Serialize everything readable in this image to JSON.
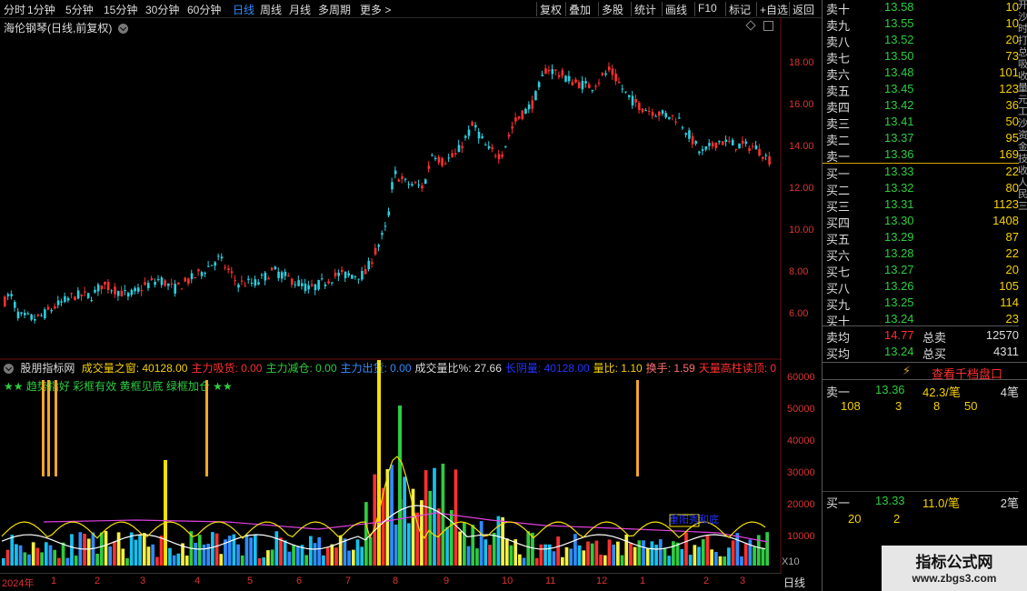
{
  "toolbar": {
    "periods": [
      "分时",
      "1分钟",
      "5分钟",
      "15分钟",
      "30分钟",
      "60分钟",
      "日线",
      "周线",
      "月线",
      "多周期",
      "更多"
    ],
    "more_suffix": "更多 >",
    "right_buttons": [
      "复权",
      "叠加",
      "多股",
      "统计",
      "画线",
      "F10",
      "标记",
      "+自选",
      "返回"
    ]
  },
  "chart_title": "海伦钢琴(日线,前复权)",
  "price_axis": [
    "18.00",
    "16.00",
    "14.00",
    "12.00",
    "10.00",
    "8.00",
    "6.00"
  ],
  "indicator": {
    "name": "股朋指标网",
    "items": [
      {
        "label": "成交量之窗:",
        "value": "40128.00",
        "color": "#f5d000"
      },
      {
        "label": "主力吸货:",
        "value": "0.00",
        "color": "#ff3030"
      },
      {
        "label": "主力减仓:",
        "value": "0.00",
        "color": "#2ecc40"
      },
      {
        "label": "主力出货:",
        "value": "0.00",
        "color": "#2f8cff"
      },
      {
        "label": "成交量比%:",
        "value": "27.66",
        "color": "#ddd"
      },
      {
        "label": "长阴量:",
        "value": "40128.00",
        "color": "#2233ff"
      },
      {
        "label": "量比:",
        "value": "1.10",
        "color": "#f5d000"
      },
      {
        "label": "换手:",
        "value": "1.59",
        "color": "#ff6f6f"
      },
      {
        "label": "天量高柱读顶:",
        "value": "0",
        "color": "#ff3030"
      }
    ],
    "subtitle": "★★ 趋势指好 彩框有效 黄框见底 绿框加仓 ★★",
    "annotation": "重阳秀和底"
  },
  "volume_axis": [
    "60000",
    "50000",
    "40000",
    "30000",
    "20000",
    "10000"
  ],
  "volume_unit": "X10",
  "time_axis": [
    "2024年",
    "1",
    "2",
    "3",
    "4",
    "5",
    "6",
    "7",
    "8",
    "9",
    "10",
    "11",
    "12",
    "1",
    "2",
    "3"
  ],
  "period_label": "日线",
  "orderbook": {
    "sell": [
      {
        "label": "卖十",
        "price": "13.58",
        "vol": "10"
      },
      {
        "label": "卖九",
        "price": "13.55",
        "vol": "10"
      },
      {
        "label": "卖八",
        "price": "13.52",
        "vol": "20"
      },
      {
        "label": "卖七",
        "price": "13.50",
        "vol": "73"
      },
      {
        "label": "卖六",
        "price": "13.48",
        "vol": "101"
      },
      {
        "label": "卖五",
        "price": "13.45",
        "vol": "123"
      },
      {
        "label": "卖四",
        "price": "13.42",
        "vol": "36"
      },
      {
        "label": "卖三",
        "price": "13.41",
        "vol": "50"
      },
      {
        "label": "卖二",
        "price": "13.37",
        "vol": "95"
      },
      {
        "label": "卖一",
        "price": "13.36",
        "vol": "169"
      }
    ],
    "buy": [
      {
        "label": "买一",
        "price": "13.33",
        "vol": "22"
      },
      {
        "label": "买二",
        "price": "13.32",
        "vol": "80"
      },
      {
        "label": "买三",
        "price": "13.31",
        "vol": "1123"
      },
      {
        "label": "买四",
        "price": "13.30",
        "vol": "1408"
      },
      {
        "label": "买五",
        "price": "13.29",
        "vol": "87"
      },
      {
        "label": "买六",
        "price": "13.28",
        "vol": "22"
      },
      {
        "label": "买七",
        "price": "13.27",
        "vol": "20"
      },
      {
        "label": "买八",
        "price": "13.26",
        "vol": "105"
      },
      {
        "label": "买九",
        "price": "13.25",
        "vol": "114"
      },
      {
        "label": "买十",
        "price": "13.24",
        "vol": "23"
      }
    ],
    "sell_avg_label": "卖均",
    "sell_avg": "14.77",
    "total_sell_label": "总卖",
    "total_sell": "12570",
    "buy_avg_label": "买均",
    "buy_avg": "13.24",
    "total_buy_label": "总买",
    "total_buy": "4311"
  },
  "qianbang_button": "查看千档盘口",
  "queue": {
    "sell1_label": "卖一",
    "sell1_price": "13.36",
    "sell1_avg": "42.3/笔",
    "sell1_count": "4笔",
    "sell1_orders": [
      "108",
      "3",
      "8",
      "50"
    ],
    "buy1_label": "买一",
    "buy1_price": "13.33",
    "buy1_avg": "11.0/笔",
    "buy1_count": "2笔",
    "buy1_orders": [
      "20",
      "2"
    ]
  },
  "edge_text": "开沙时打总吸收量元工沙资金技收人民三",
  "watermark": {
    "title": "指标公式网",
    "url": "www.zbgs3.com"
  },
  "colors": {
    "up": "#ff3030",
    "down": "#2ad0e0",
    "accent": "#2f8cff",
    "yellow": "#f5d000"
  }
}
